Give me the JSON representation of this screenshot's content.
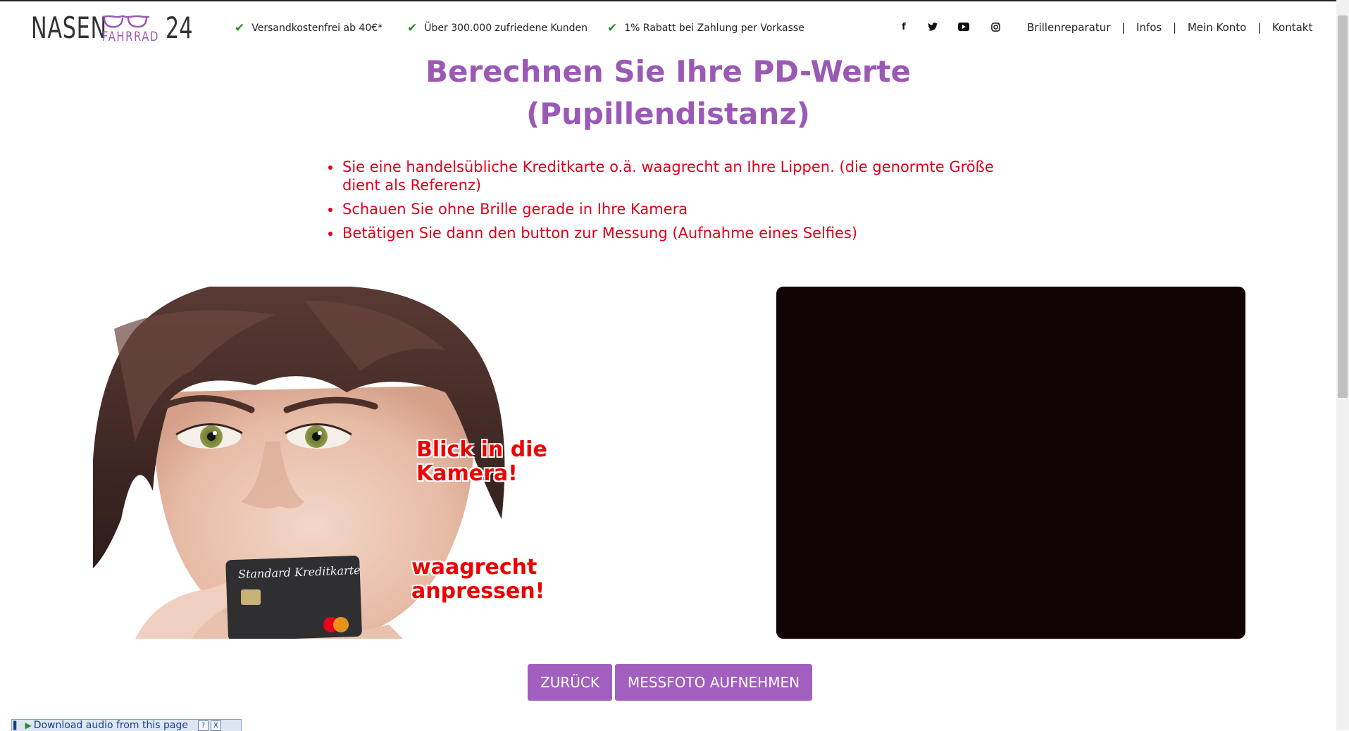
{
  "header": {
    "logo": {
      "main": "NASEN",
      "sub": "FAHRRAD",
      "number": "24"
    },
    "usps": [
      {
        "label": "Versandkostenfrei ab 40€*"
      },
      {
        "label": "Über 300.000 zufriedene Kunden"
      },
      {
        "label": "1% Rabatt bei Zahlung per Vorkasse"
      }
    ],
    "social": [
      {
        "icon": "facebook-icon",
        "glyph": "f"
      },
      {
        "icon": "twitter-icon",
        "glyph": "🐦"
      },
      {
        "icon": "youtube-icon",
        "glyph": "▶"
      },
      {
        "icon": "instagram-icon",
        "glyph": "◎"
      }
    ],
    "nav": [
      {
        "label": "Brillenreparatur"
      },
      {
        "label": "Infos"
      },
      {
        "label": "Mein Konto"
      },
      {
        "label": "Kontakt"
      }
    ],
    "nav_separator": "|"
  },
  "main": {
    "title_line1": "Berechnen Sie Ihre PD-Werte",
    "title_line2": "(Pupillendistanz)",
    "instructions": [
      "Sie eine handelsübliche Kreditkarte o.ä. waagrecht an Ihre Lippen. (die genormte Größe dient als Referenz)",
      "Schauen Sie ohne Brille gerade in Ihre Kamera",
      "Betätigen Sie dann den button zur Messung (Aufnahme eines Selfies)"
    ],
    "illustration": {
      "text_look_line1": "Blick in die",
      "text_look_line2": "Kamera!",
      "text_press_line1": "waagrecht",
      "text_press_line2": "anpressen!",
      "card_label": "Standard Kreditkarte"
    },
    "buttons": {
      "back": "ZURÜCK",
      "capture": "MESSFOTO AUFNEHMEN"
    }
  },
  "download_bar": {
    "label": "Download audio from this page",
    "help": "?",
    "close": "X"
  },
  "colors": {
    "accent": "#9b59b6",
    "button": "#a35fc0",
    "instruction_red": "#e0001b",
    "camera_bg": "#120406"
  }
}
